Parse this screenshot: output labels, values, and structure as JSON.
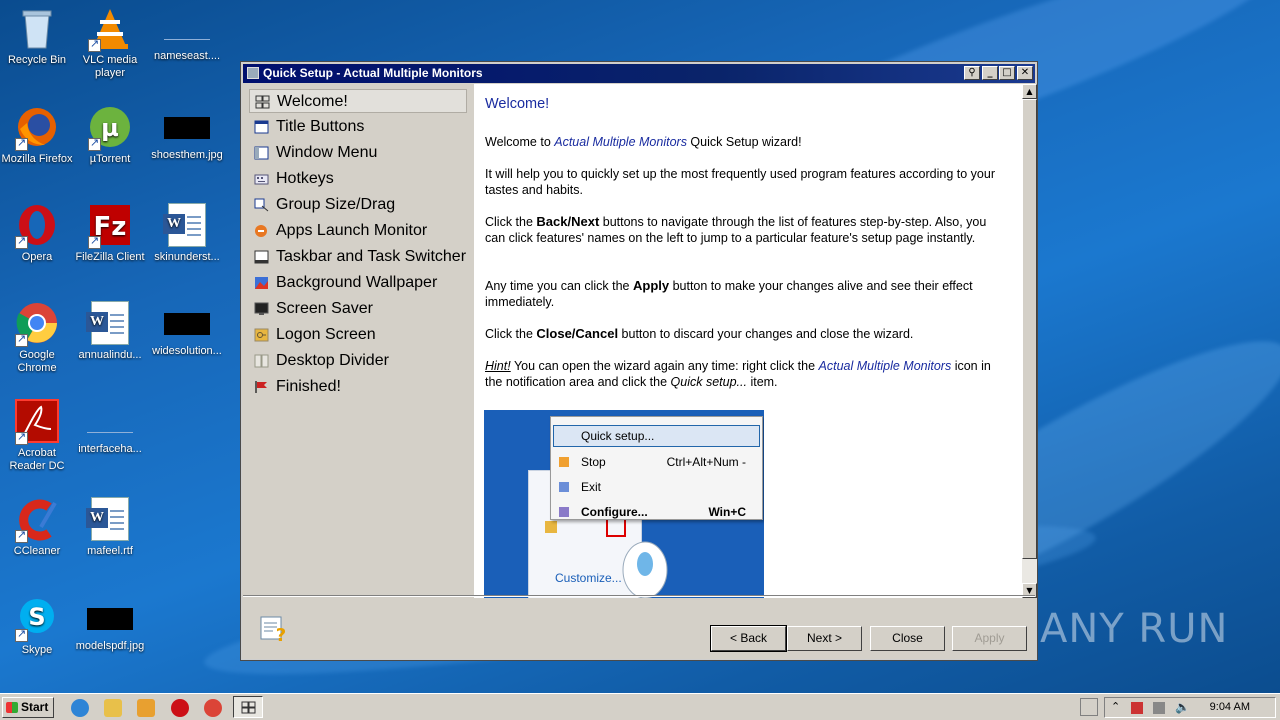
{
  "desktop": {
    "icons": [
      {
        "label": "Recycle Bin"
      },
      {
        "label": "VLC media player"
      },
      {
        "label": "nameseast...."
      },
      {
        "label": "Mozilla Firefox"
      },
      {
        "label": "µTorrent"
      },
      {
        "label": "shoesthem.jpg"
      },
      {
        "label": "Opera"
      },
      {
        "label": "FileZilla Client"
      },
      {
        "label": "skinunderst..."
      },
      {
        "label": "Google Chrome"
      },
      {
        "label": "annualindu..."
      },
      {
        "label": "widesolution..."
      },
      {
        "label": "Acrobat Reader DC"
      },
      {
        "label": "interfaceha..."
      },
      {
        "label": "CCleaner"
      },
      {
        "label": "mafeel.rtf"
      },
      {
        "label": "Skype"
      },
      {
        "label": "modelspdf.jpg"
      }
    ],
    "watermark": "ANY RUN"
  },
  "window": {
    "title": "Quick Setup - Actual Multiple Monitors",
    "nav": [
      {
        "label": "Welcome!",
        "selected": true
      },
      {
        "label": "Title Buttons"
      },
      {
        "label": "Window Menu"
      },
      {
        "label": "Hotkeys"
      },
      {
        "label": "Group Size/Drag"
      },
      {
        "label": "Apps Launch Monitor"
      },
      {
        "label": "Taskbar and Task Switcher"
      },
      {
        "label": "Background Wallpaper"
      },
      {
        "label": "Screen Saver"
      },
      {
        "label": "Logon Screen"
      },
      {
        "label": "Desktop Divider"
      },
      {
        "label": "Finished!"
      }
    ],
    "content": {
      "heading": "Welcome!",
      "p1_pre": "Welcome to ",
      "p1_app": "Actual Multiple Monitors",
      "p1_post": " Quick Setup wizard!",
      "p2": "It will help you to quickly set up the most frequently used program features according to your tastes and habits.",
      "p3_pre": "Click the ",
      "p3_bold": "Back/Next",
      "p3_post": " buttons to navigate through the list of features step-by-step. Also, you can click features' names on the left to jump to a particular feature's setup page instantly.",
      "p4_pre": "Any time you can click the ",
      "p4_bold": "Apply",
      "p4_post": " button to make your changes alive and see their effect immediately.",
      "p5_pre": "Click the ",
      "p5_bold": "Close/Cancel",
      "p5_post": " button to discard your changes and close the wizard.",
      "hint_label": "Hint!",
      "hint_pre": " You can open the wizard again any time: right click the ",
      "hint_app": "Actual Multiple Monitors",
      "hint_mid": " icon in the notification area and click the ",
      "hint_item": "Quick setup...",
      "hint_post": " item."
    },
    "example_menu": {
      "items": [
        {
          "label": "Quick setup...",
          "shortcut": ""
        },
        {
          "label": "Stop",
          "shortcut": "Ctrl+Alt+Num -"
        },
        {
          "label": "Exit",
          "shortcut": ""
        },
        {
          "label": "Configure...",
          "shortcut": "Win+C"
        }
      ],
      "customize": "Customize..."
    },
    "buttons": {
      "back": "< Back",
      "next": "Next >",
      "close": "Close",
      "apply": "Apply"
    }
  },
  "taskbar": {
    "start": "Start",
    "clock": "9:04 AM"
  }
}
